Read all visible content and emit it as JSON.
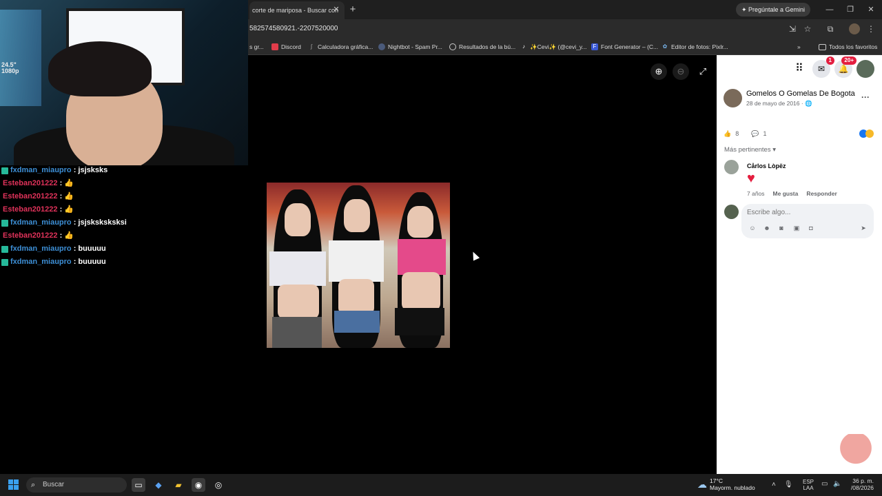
{
  "browser": {
    "tab_title": "corte de mariposa - Buscar con",
    "gemini_label": "Pregúntale a Gemini",
    "url": "582574580921.-2207520000",
    "bookmarks": [
      "Discord",
      "Calculadora gráfica...",
      "Nightbot - Spam Pr...",
      "Resultados de la bú...",
      "✨Cevi✨ (@cevi_y...",
      "Font Generator – (C...",
      "Editor de fotos: Pixlr..."
    ],
    "bookmark_partial": "s gr...",
    "all_favorites": "Todos los favoritos"
  },
  "webcam": {
    "monitor_text_line1": "24.5\"",
    "monitor_text_line2": "1080p"
  },
  "chat": [
    {
      "user": "fxdman_miaupro",
      "msg": ": jsjsksks",
      "color": "blue",
      "badge": true
    },
    {
      "user": "Esteban201222",
      "msg": ":",
      "color": "red",
      "badge": false,
      "emoji": true
    },
    {
      "user": "Esteban201222",
      "msg": ":",
      "color": "red",
      "badge": false,
      "emoji": true
    },
    {
      "user": "Esteban201222",
      "msg": ":",
      "color": "red",
      "badge": false,
      "emoji": true
    },
    {
      "user": "fxdman_miaupro",
      "msg": ": jsjsksksksksi",
      "color": "blue",
      "badge": true
    },
    {
      "user": "Esteban201222",
      "msg": ":",
      "color": "red",
      "badge": false,
      "emoji": true
    },
    {
      "user": "fxdman_miaupro",
      "msg": ": buuuuu",
      "color": "blue",
      "badge": true
    },
    {
      "user": "fxdman_miaupro",
      "msg": ": buuuuu",
      "color": "blue",
      "badge": true
    }
  ],
  "facebook": {
    "notifications": {
      "messenger_count": "1",
      "notifications_count": "20+"
    },
    "post": {
      "page_name": "Gomelos O Gomelas De Bogota",
      "date": "28 de mayo de 2016 · ",
      "likes": "8",
      "comments": "1"
    },
    "comments_filter": "Más pertinentes",
    "comment": {
      "author": "Cårlos Lòpëz",
      "age": "7 años",
      "like_label": "Me gusta",
      "reply_label": "Responder"
    },
    "composer_placeholder": "Escribe algo..."
  },
  "taskbar": {
    "search_placeholder": "Buscar",
    "weather_temp": "17°C",
    "weather_desc": "Mayorm. nublado",
    "lang_line1": "ESP",
    "lang_line2": "LAA",
    "time": "36 p. m.",
    "date": "/08/2026"
  },
  "colors": {
    "accent_blue": "#3d8fd6",
    "accent_red": "#e0325a",
    "fb_notification": "#e41e3f"
  }
}
